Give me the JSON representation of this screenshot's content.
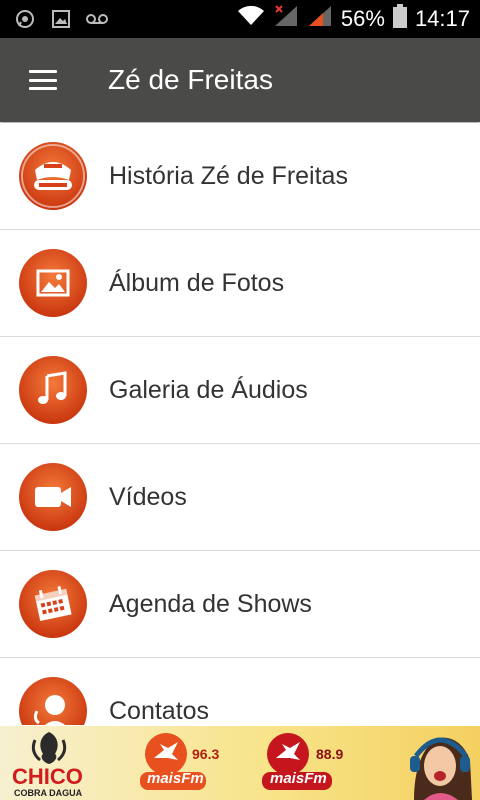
{
  "status_bar": {
    "battery": "56%",
    "time": "14:17",
    "icons": [
      "whatsapp-icon",
      "image-icon",
      "voicemail-icon",
      "wifi-icon",
      "signal-icon",
      "signal-icon",
      "battery-icon"
    ]
  },
  "toolbar": {
    "title": "Zé de Freitas",
    "menu_icon": "hamburger-menu-icon"
  },
  "menu": {
    "items": [
      {
        "label": "História Zé de Freitas",
        "icon": "logo-badge-icon"
      },
      {
        "label": "Álbum de Fotos",
        "icon": "photo-icon"
      },
      {
        "label": "Galeria de Áudios",
        "icon": "music-note-icon"
      },
      {
        "label": "Vídeos",
        "icon": "video-camera-icon"
      },
      {
        "label": "Agenda de Shows",
        "icon": "calendar-icon"
      },
      {
        "label": "Contatos",
        "icon": "contact-icon"
      }
    ]
  },
  "banner": {
    "chico_name": "CHICO",
    "chico_sub": "COBRA DAGUA",
    "mais1": {
      "name": "maisFm",
      "freq": "96.3"
    },
    "mais2": {
      "name": "maisFm",
      "freq": "88.9"
    }
  },
  "colors": {
    "accent": "#e8501f",
    "toolbar": "#4a4a48",
    "status_bar": "#000000"
  }
}
